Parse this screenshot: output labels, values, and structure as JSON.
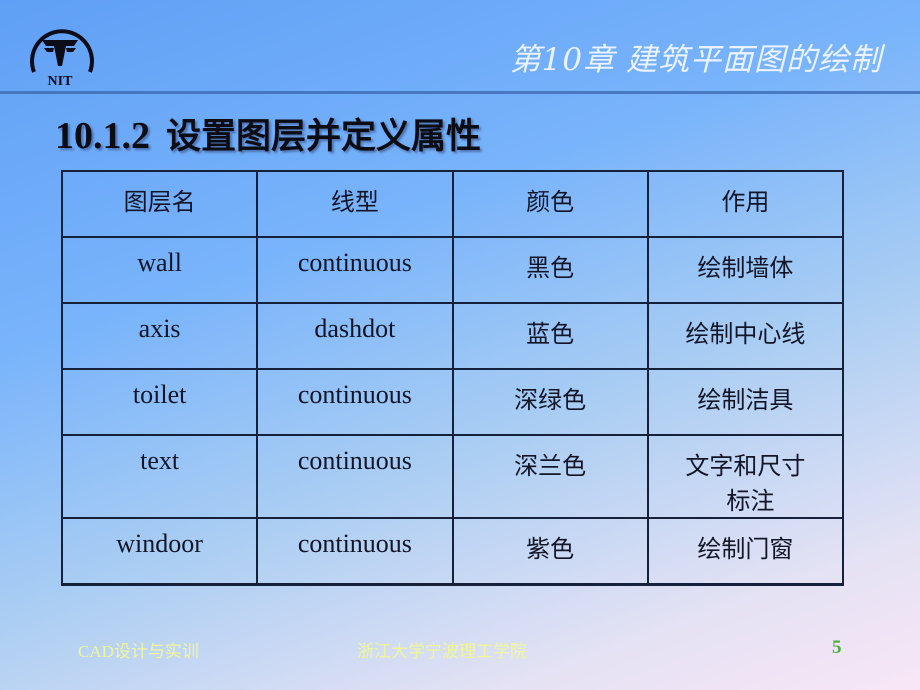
{
  "header": {
    "logo_text": "NIT",
    "chapter_title": "第10章  建筑平面图的绘制"
  },
  "section": {
    "number": "10.1.2",
    "title": "设置图层并定义属性"
  },
  "table": {
    "headers": [
      "图层名",
      "线型",
      "颜色",
      "作用"
    ],
    "rows": [
      {
        "name": "wall",
        "linetype": "continuous",
        "color": "黑色",
        "purpose": "绘制墙体",
        "purpose_line2": ""
      },
      {
        "name": "axis",
        "linetype": "dashdot",
        "color": "蓝色",
        "purpose": "绘制中心线",
        "purpose_line2": ""
      },
      {
        "name": "toilet",
        "linetype": "continuous",
        "color": "深绿色",
        "purpose": "绘制洁具",
        "purpose_line2": ""
      },
      {
        "name": "text",
        "linetype": "continuous",
        "color": "深兰色",
        "purpose": "文字和尺寸",
        "purpose_line2": "标注"
      },
      {
        "name": "windoor",
        "linetype": "continuous",
        "color": "紫色",
        "purpose": "绘制门窗",
        "purpose_line2": ""
      }
    ]
  },
  "footer": {
    "course": "CAD设计与实训",
    "institution": "浙江大学宁波理工学院",
    "page_number": "5"
  }
}
